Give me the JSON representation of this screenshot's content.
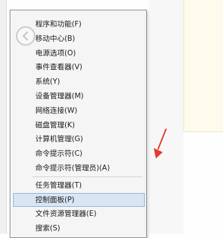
{
  "menu": {
    "group1": [
      {
        "label": "程序和功能(F)"
      },
      {
        "label": "移动中心(B)"
      },
      {
        "label": "电源选项(O)"
      },
      {
        "label": "事件查看器(V)"
      },
      {
        "label": "系统(Y)"
      },
      {
        "label": "设备管理器(M)"
      },
      {
        "label": "网络连接(W)"
      },
      {
        "label": "磁盘管理(K)"
      },
      {
        "label": "计算机管理(G)"
      },
      {
        "label": "命令提示符(C)"
      },
      {
        "label": "命令提示符(管理员)(A)"
      }
    ],
    "group2": [
      {
        "label": "任务管理器(T)"
      },
      {
        "label": "控制面板(P)",
        "highlighted": true
      },
      {
        "label": "文件资源管理器(E)"
      },
      {
        "label": "搜索(S)"
      }
    ]
  },
  "colors": {
    "highlight_bg": "#d8e6f4",
    "highlight_border": "#8fb3d9",
    "annotation_arrow": "#e53a2e"
  },
  "icons": {
    "back": "back-arrow-circle-icon",
    "pointer": "annotation-arrow-icon"
  }
}
